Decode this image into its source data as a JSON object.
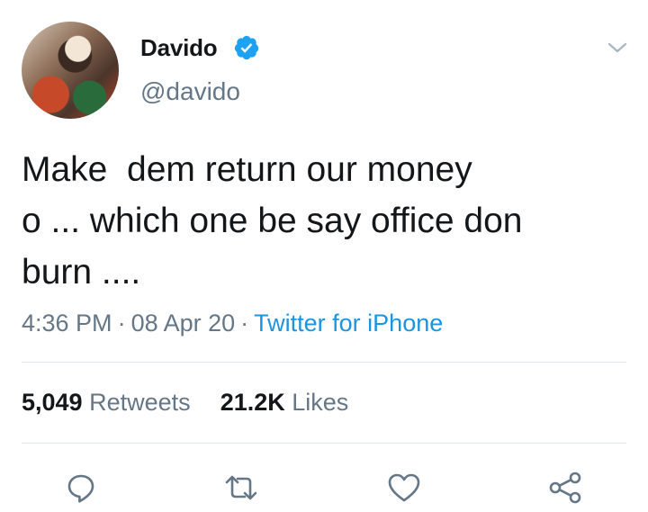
{
  "author": {
    "name": "Davido",
    "handle": "@davido",
    "verified": true
  },
  "tweet": {
    "text": "Make  dem return our money\no ... which one be say office don\nburn ....",
    "time": "4:36 PM",
    "separator": "·",
    "date": "08 Apr 20",
    "source": "Twitter for iPhone"
  },
  "stats": {
    "retweets_count": "5,049",
    "retweets_label": "Retweets",
    "likes_count": "21.2K",
    "likes_label": "Likes"
  },
  "actions": {
    "icons": [
      "reply-icon",
      "retweet-icon",
      "like-icon",
      "share-icon"
    ]
  },
  "colors": {
    "text": "#14171a",
    "secondary": "#657786",
    "link": "#1b95e0",
    "verified": "#1da1f2",
    "divider": "#e1e8ed"
  }
}
